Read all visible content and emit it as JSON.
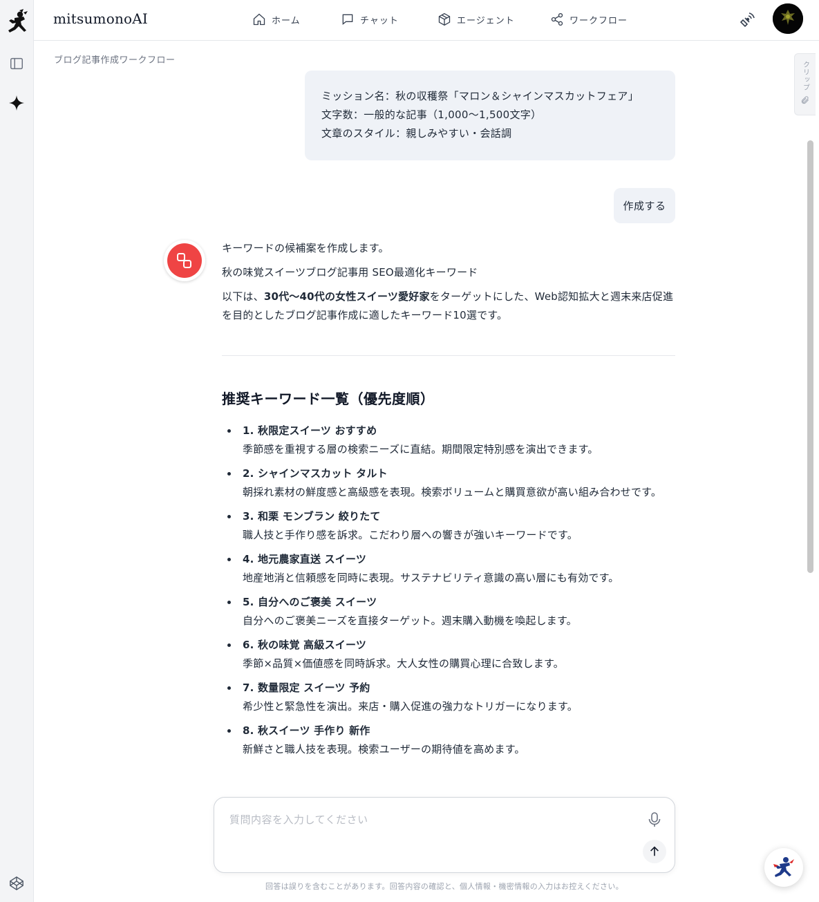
{
  "app": {
    "brand": "mitsumonoAI"
  },
  "nav": [
    {
      "label": "ホーム",
      "icon": "home-icon"
    },
    {
      "label": "チャット",
      "icon": "chat-icon"
    },
    {
      "label": "エージェント",
      "icon": "cube-icon"
    },
    {
      "label": "ワークフロー",
      "icon": "share-icon"
    }
  ],
  "breadcrumb": "ブログ記事作成ワークフロー",
  "clip_tab": {
    "label": "クリップ"
  },
  "prompt": {
    "line1": "ミッション名：秋の収穫祭「マロン＆シャインマスカットフェア」",
    "line2": "文字数：一般的な記事（1,000〜1,500文字）",
    "line3": "文章のスタイル：親しみやすい・会話調"
  },
  "user_message": "作成する",
  "answer": {
    "intro": "キーワードの候補案を作成します。",
    "subtitle": "秋の味覚スイーツブログ記事用 SEO最適化キーワード",
    "lead_prefix": "以下は、",
    "lead_bold": "30代〜40代の女性スイーツ愛好家",
    "lead_suffix": "をターゲットにした、Web認知拡大と週末来店促進を目的としたブログ記事作成に適したキーワード10選です。",
    "heading": "推奨キーワード一覧（優先度順）",
    "keywords": [
      {
        "kw": "1. 秋限定スイーツ おすすめ",
        "desc": "季節感を重視する層の検索ニーズに直結。期間限定特別感を演出できます。"
      },
      {
        "kw": "2. シャインマスカット タルト",
        "desc": "朝採れ素材の鮮度感と高級感を表現。検索ボリュームと購買意欲が高い組み合わせです。"
      },
      {
        "kw": "3. 和栗 モンブラン 絞りたて",
        "desc": "職人技と手作り感を訴求。こだわり層への響きが強いキーワードです。"
      },
      {
        "kw": "4. 地元農家直送 スイーツ",
        "desc": "地産地消と信頼感を同時に表現。サステナビリティ意識の高い層にも有効です。"
      },
      {
        "kw": "5. 自分へのご褒美 スイーツ",
        "desc": "自分へのご褒美ニーズを直接ターゲット。週末購入動機を喚起します。"
      },
      {
        "kw": "6. 秋の味覚 高級スイーツ",
        "desc": "季節×品質×価値感を同時訴求。大人女性の購買心理に合致します。"
      },
      {
        "kw": "7. 数量限定 スイーツ 予約",
        "desc": "希少性と緊急性を演出。来店・購入促進の強力なトリガーになります。"
      },
      {
        "kw": "8. 秋スイーツ 手作り 新作",
        "desc": "新鮮さと職人技を表現。検索ユーザーの期待値を高めます。"
      }
    ]
  },
  "composer": {
    "placeholder": "質問内容を入力してください",
    "value": ""
  },
  "disclaimer": "回答は誤りを含むことがあります。回答内容の確認と、個人情報・機密情報の入力はお控えください。",
  "colors": {
    "bot_accent": "#ef4444",
    "bubble_bg": "#eff2f7",
    "rail_bg": "#f3f4f6"
  }
}
